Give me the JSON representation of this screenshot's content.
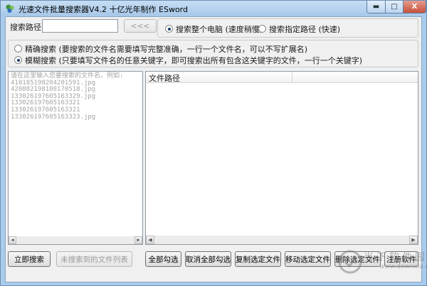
{
  "window": {
    "title": "光速文件批量搜索器V4.2 十亿光年制作 ESword",
    "min_glyph": "▬",
    "max_glyph": "□",
    "close_glyph": "X"
  },
  "search_path": {
    "label": "搜索路径",
    "value": "",
    "browse_label": "<<<"
  },
  "scope": {
    "whole_pc_label": "搜索整个电脑 (速度稍慢)",
    "specified_path_label": "搜索指定路径 (快速)",
    "selected": "whole_pc"
  },
  "mode": {
    "exact_label": "精确搜索 (要搜索的文件名需要填写完整准确，一行一个文件名，可以不写扩展名)",
    "fuzzy_label": "模糊搜索 (只要填写文件名的任意关键字，即可搜索出所有包含这关键字的文件，一行一个关键字)",
    "selected": "fuzzy"
  },
  "names_input": {
    "placeholder_lines": [
      "请在这里输入您要搜索的文件名，例如:",
      "410185198204201591.jpg",
      "420882198108170518.jpg",
      "133026197605163329.jpg",
      "133026197605163321",
      "133026197605163321",
      "133026197605163323.jpg"
    ]
  },
  "results": {
    "column_header": "文件路径"
  },
  "buttons": {
    "search_now": "立即搜索",
    "not_found_list": "未搜索到的文件列表",
    "select_all": "全部勾选",
    "deselect_all": "取消全部勾选",
    "copy_selected": "复制选定文件",
    "move_selected": "移动选定文件",
    "delete_selected": "删除选定文件",
    "register": "注册软件"
  },
  "watermark": {
    "text": "当下软件园",
    "url": "www.downxia.com"
  },
  "colors": {
    "title_bar": "#a7c8ea",
    "client_bg": "#f0f0f0",
    "close_button": "#c8513a",
    "placeholder_text": "#a3a3a3"
  }
}
